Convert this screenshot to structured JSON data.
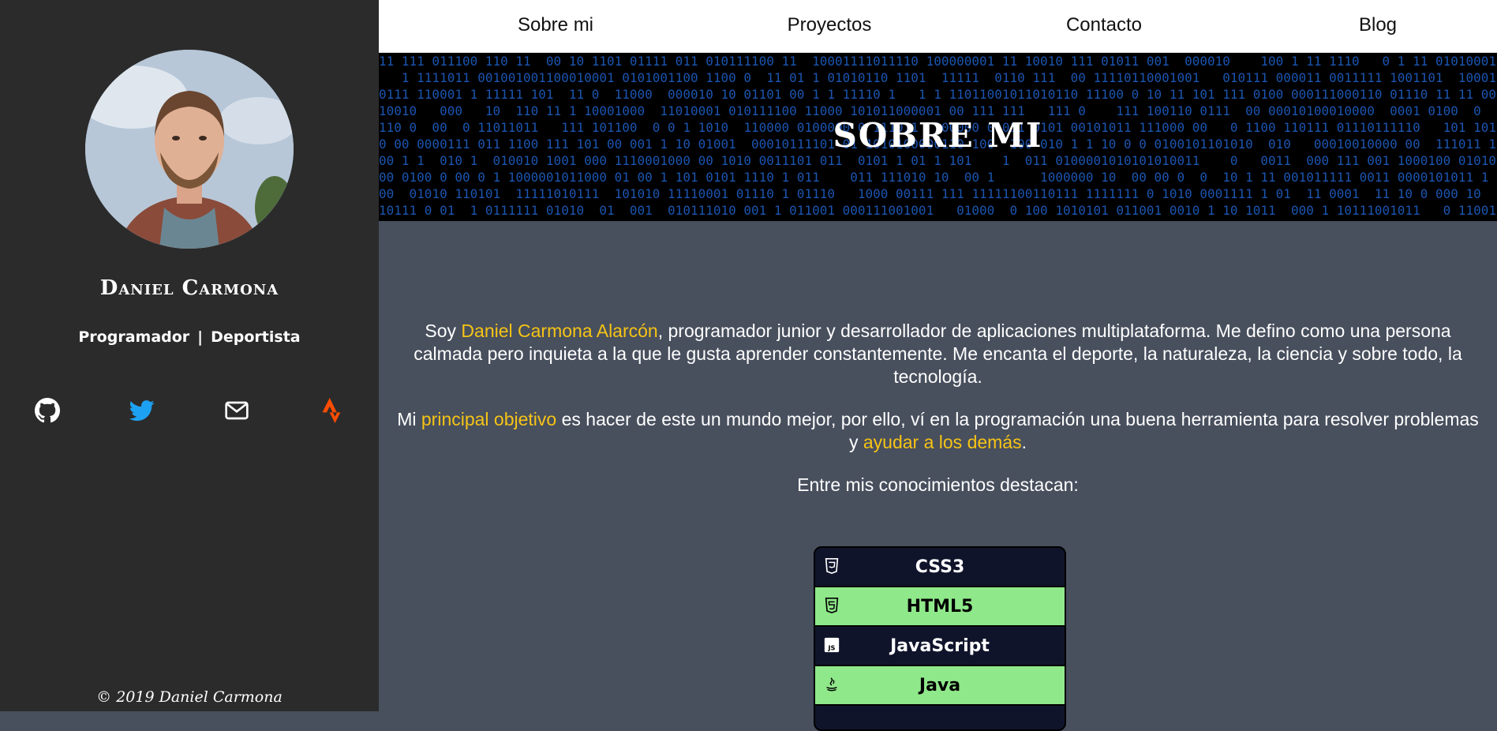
{
  "sidebar": {
    "name": "Daniel Carmona",
    "roles": [
      "Programador",
      "Deportista"
    ],
    "role_separator": "|",
    "socials": [
      {
        "icon": "github-icon",
        "color": "#ffffff"
      },
      {
        "icon": "twitter-icon",
        "color": "#1da1f2"
      },
      {
        "icon": "mail-icon",
        "color": "#ffffff"
      },
      {
        "icon": "strava-icon",
        "color": "#fc4c02"
      }
    ],
    "footer": "© 2019 Daniel Carmona"
  },
  "nav": {
    "items": [
      "Sobre mi",
      "Proyectos",
      "Contacto",
      "Blog"
    ]
  },
  "banner": {
    "title": "SOBRE MI"
  },
  "about": {
    "p1_prefix": "Soy ",
    "p1_highlight": "Daniel Carmona Alarcón",
    "p1_rest": ", programador junior y desarrollador de aplicaciones multiplataforma. Me defino como una persona calmada pero inquieta a la que le gusta aprender constantemente. Me encanta el deporte, la naturaleza, la ciencia y sobre todo, la tecnología.",
    "p2_prefix": "Mi ",
    "p2_highlight1": "principal objetivo",
    "p2_middle": " es hacer de este un mundo mejor, por ello, ví en la programación una buena herramienta para resolver problemas y ",
    "p2_highlight2": "ayudar a los demás",
    "p2_suffix": ".",
    "p3": "Entre mis conocimientos destacan:"
  },
  "skills": [
    {
      "label": "CSS3",
      "icon": "css3-icon",
      "style": "dark"
    },
    {
      "label": "HTML5",
      "icon": "html5-icon",
      "style": "light"
    },
    {
      "label": "JavaScript",
      "icon": "javascript-icon",
      "style": "dark"
    },
    {
      "label": "Java",
      "icon": "java-icon",
      "style": "light"
    }
  ],
  "colors": {
    "sidebar_bg": "#2b2b2b",
    "content_bg": "#484f5d",
    "highlight": "#f6c415",
    "skill_dark": "#10142b",
    "skill_light": "#8fe88a"
  }
}
